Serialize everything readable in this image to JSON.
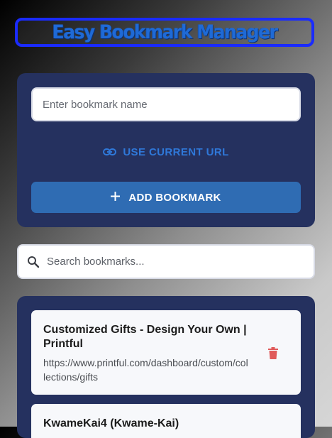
{
  "app": {
    "title": "Easy Bookmark Manager",
    "accent_color": "#2f6cb3",
    "panel_color": "#25315f",
    "title_border_color": "#1a2bff",
    "delete_color": "#e05a5a"
  },
  "add_form": {
    "name_placeholder": "Enter bookmark name",
    "name_value": "",
    "use_current_url_label": "USE CURRENT URL",
    "use_current_url_icon": "link-icon",
    "add_button_label": "ADD BOOKMARK",
    "add_button_icon": "plus-icon"
  },
  "search": {
    "placeholder": "Search bookmarks...",
    "value": "",
    "icon": "search-icon"
  },
  "bookmarks": [
    {
      "title": "Customized Gifts - Design Your Own | Printful",
      "url": "https://www.printful.com/dashboard/custom/collections/gifts",
      "delete_icon": "trash-icon"
    },
    {
      "title": "KwameKai4 (Kwame-Kai)",
      "url": "",
      "delete_icon": "trash-icon"
    }
  ]
}
